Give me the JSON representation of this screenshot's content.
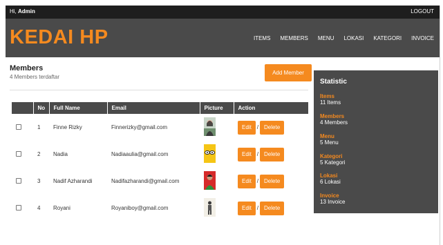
{
  "topbar": {
    "greeting_prefix": "Hi, ",
    "user": "Admin",
    "logout": "LOGOUT"
  },
  "header": {
    "brand": "KEDAI HP",
    "nav": [
      "ITEMS",
      "MEMBERS",
      "MENU",
      "LOKASI",
      "KATEGORI",
      "INVOICE"
    ]
  },
  "main": {
    "title": "Members",
    "subtitle": "4 Members terdaftar",
    "add_button": "Add Member",
    "columns": [
      "",
      "No",
      "Full Name",
      "Email",
      "Picture",
      "Action"
    ],
    "rows": [
      {
        "no": "1",
        "name": "Finne Rizky",
        "email": "Finnerizky@gmail.com"
      },
      {
        "no": "2",
        "name": "Nadia",
        "email": "Nadiaaulia@gmail.com"
      },
      {
        "no": "3",
        "name": "Nadif Azharandi",
        "email": "Nadifazharandi@gmail.com"
      },
      {
        "no": "4",
        "name": "Royani",
        "email": "Royaniboy@gmail.com"
      }
    ],
    "edit_label": "Edit",
    "separator": "/",
    "delete_label": "Delete"
  },
  "statistic": {
    "title": "Statistic",
    "items": [
      {
        "key": "Items",
        "value": "11 Items"
      },
      {
        "key": "Members",
        "value": "4 Members"
      },
      {
        "key": "Menu",
        "value": "5 Menu"
      },
      {
        "key": "Kategori",
        "value": "5 Kategori"
      },
      {
        "key": "Lokasi",
        "value": "6 Lokasi"
      },
      {
        "key": "Invoice",
        "value": "13 Invoice"
      }
    ]
  },
  "colors": {
    "accent": "#f58a1f",
    "dark": "#4a4a4a",
    "topbar": "#1e1e1e"
  }
}
